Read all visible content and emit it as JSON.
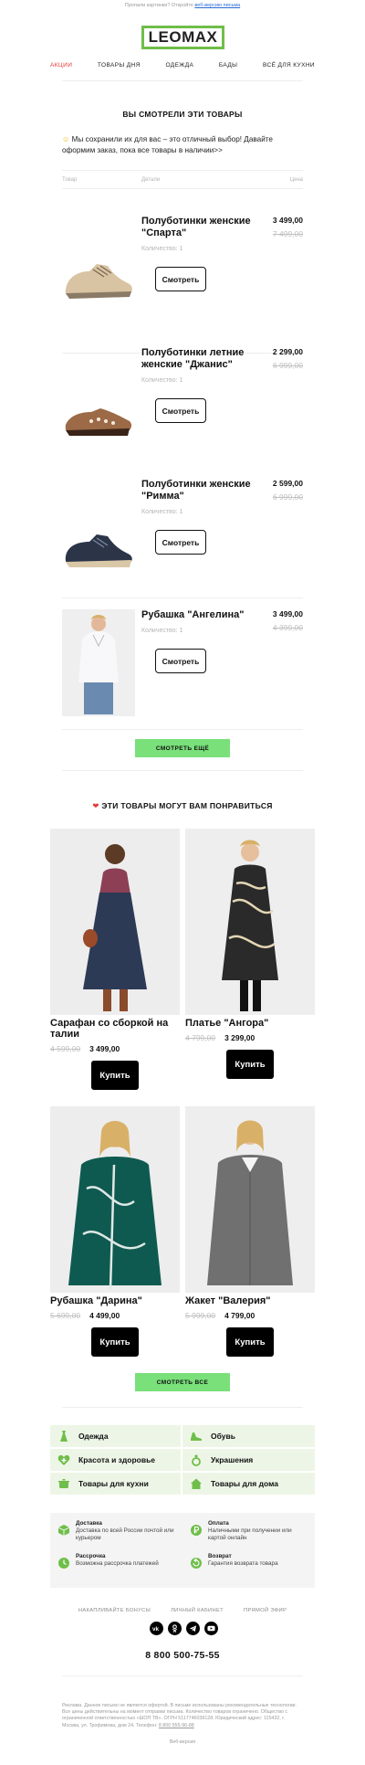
{
  "preheader": {
    "text": "Пропали картинки? Откройте ",
    "link": "веб-версию письма"
  },
  "brand": {
    "logo_text": "LEOMAX",
    "accent": "#6fbe4a"
  },
  "nav": [
    "АКЦИИ",
    "ТОВАРЫ ДНЯ",
    "ОДЕЖДА",
    "БАДЫ",
    "ВСЁ ДЛЯ КУХНИ"
  ],
  "viewed": {
    "title": "ВЫ СМОТРЕЛИ ЭТИ ТОВАРЫ",
    "intro": "Мы сохранили их для вас – это отличный выбор! Давайте оформим заказ, пока все товары в наличии>>",
    "columns": [
      "Товар",
      "Детали",
      "Цена"
    ],
    "items": [
      {
        "name": "Полуботинки женские \"Спарта\"",
        "qty": "Количество: 1",
        "price": "3 499,00",
        "old": "7 499,00",
        "button": "Смотреть",
        "icon": "beige-sneaker-icon"
      },
      {
        "name": "Полуботинки летние женские \"Джанис\"",
        "qty": "Количество: 1",
        "price": "2 299,00",
        "old": "6 999,00",
        "button": "Смотреть",
        "icon": "brown-sandal-shoe-icon"
      },
      {
        "name": "Полуботинки женские \"Римма\"",
        "qty": "Количество: 1",
        "price": "2 599,00",
        "old": "6 999,00",
        "button": "Смотреть",
        "icon": "navy-sneaker-icon"
      },
      {
        "name": "Рубашка \"Ангелина\"",
        "qty": "Количество: 1",
        "price": "3 499,00",
        "old": "4 399,00",
        "button": "Смотреть",
        "icon": "white-shirt-photo"
      }
    ],
    "more_button": "СМОТРЕТЬ ЕЩЁ"
  },
  "recommend": {
    "title": "ЭТИ ТОВАРЫ МОГУТ ВАМ ПОНРАВИТЬСЯ",
    "items": [
      {
        "name": "Сарафан со сборкой на талии",
        "old": "4 599,00",
        "price": "3 499,00",
        "button": "Купить",
        "color": "#2c3a55"
      },
      {
        "name": "Платье \"Ангора\"",
        "old": "4 799,00",
        "price": "3 299,00",
        "button": "Купить",
        "color": "#2a2a2a"
      },
      {
        "name": "Рубашка \"Дарина\"",
        "old": "5 699,00",
        "price": "4 499,00",
        "button": "Купить",
        "color": "#0f5a50"
      },
      {
        "name": "Жакет \"Валерия\"",
        "old": "5 999,00",
        "price": "4 799,00",
        "button": "Купить",
        "color": "#707070"
      }
    ],
    "all_button": "СМОТРЕТЬ ВСЕ"
  },
  "categories": [
    {
      "label": "Одежда",
      "icon": "dress-icon"
    },
    {
      "label": "Обувь",
      "icon": "shoe-icon"
    },
    {
      "label": "Красота и здоровье",
      "icon": "heart-plus-icon"
    },
    {
      "label": "Украшения",
      "icon": "ring-icon"
    },
    {
      "label": "Товары для кухни",
      "icon": "pot-icon"
    },
    {
      "label": "Товары для дома",
      "icon": "house-icon"
    }
  ],
  "info": [
    {
      "title": "Доставка",
      "text": "Доставка по всей России почтой или курьером",
      "icon": "box-icon"
    },
    {
      "title": "Оплата",
      "text": "Наличными при получении или картой онлайн",
      "icon": "ruble-coin-icon"
    },
    {
      "title": "Рассрочка",
      "text": "Возможна рассрочка платежей",
      "icon": "clock-icon"
    },
    {
      "title": "Возврат",
      "text": "Гарантия возврата товара",
      "icon": "return-icon"
    }
  ],
  "footer": {
    "links": [
      "НАКАПЛИВАЙТЕ БОНУСЫ",
      "ЛИЧНЫЙ КАБИНЕТ",
      "ПРЯМОЙ ЭФИР"
    ],
    "socials": [
      "vk-icon",
      "odnoklassniki-icon",
      "telegram-icon",
      "youtube-icon"
    ],
    "phone": "8 800 500-75-55",
    "legal": "Реклама. Данное письмо не является офертой. В письме использованы рекомендательные технологии. Все цены действительны на момент отправки письма. Количество товаров ограничено. Общество с ограниченной ответственностью «ШОП ТВ». ОГРН 5117746038128. Юридический адрес: 115432, г. Москва, ул. Трофимова, дом 24. Телефон: ",
    "legal_phone": "8 800 555-96-88",
    "weblink": "Веб-версия"
  }
}
